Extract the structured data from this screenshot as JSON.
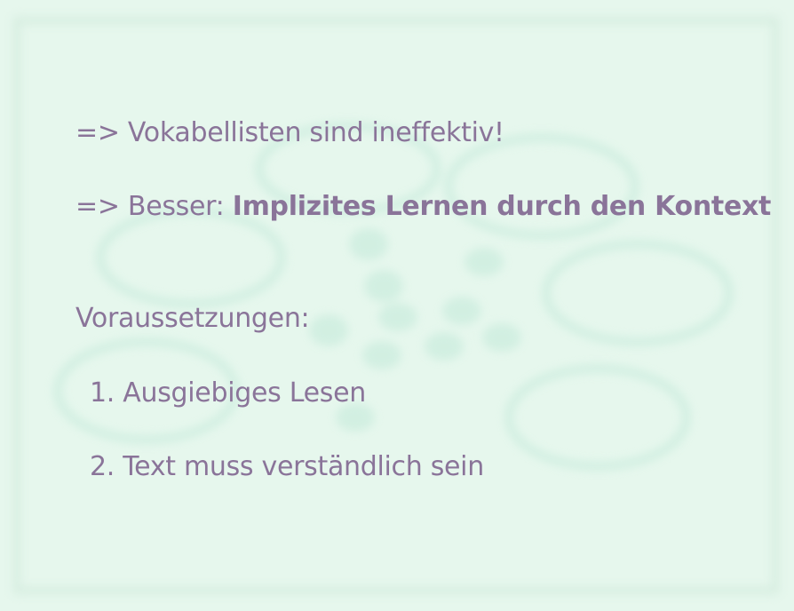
{
  "slide": {
    "line1": "=> Vokabellisten sind ineffektiv!",
    "line2_prefix": "=> Besser: ",
    "line2_bold": "Implizites Lernen durch den Kontext",
    "prerequisites_heading": "Voraussetzungen:",
    "items": [
      "1. Ausgiebiges Lesen",
      "2. Text muss verständlich sein"
    ]
  },
  "colors": {
    "background": "#e6f7ed",
    "text": "#8a7499",
    "decoration": "#cfeee0"
  }
}
